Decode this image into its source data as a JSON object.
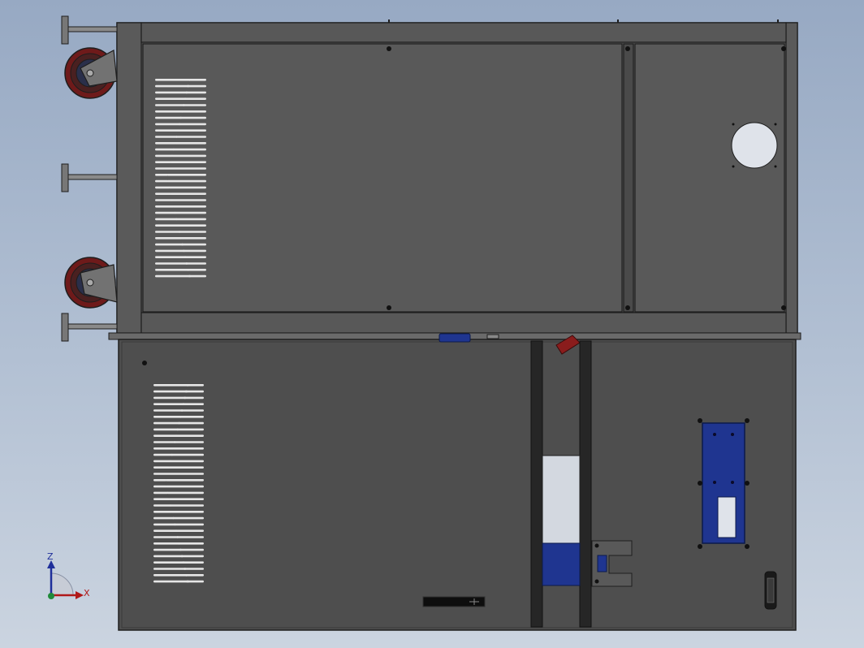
{
  "view": {
    "background_top": "#97a9c3",
    "background_bottom": "#cbd4e0",
    "panel_color": "#4e4e4e",
    "frame_color": "#545454",
    "edge_color": "#1e1e1e",
    "wheel_color": "#6e1a1a",
    "accent_blue": "#1f3590",
    "accent_red": "#8a1c1c"
  },
  "triad": {
    "z_label": "Z",
    "x_label": "X",
    "z_color": "#1f2f9a",
    "x_color": "#b01818",
    "origin_color": "#1f8a3a"
  }
}
